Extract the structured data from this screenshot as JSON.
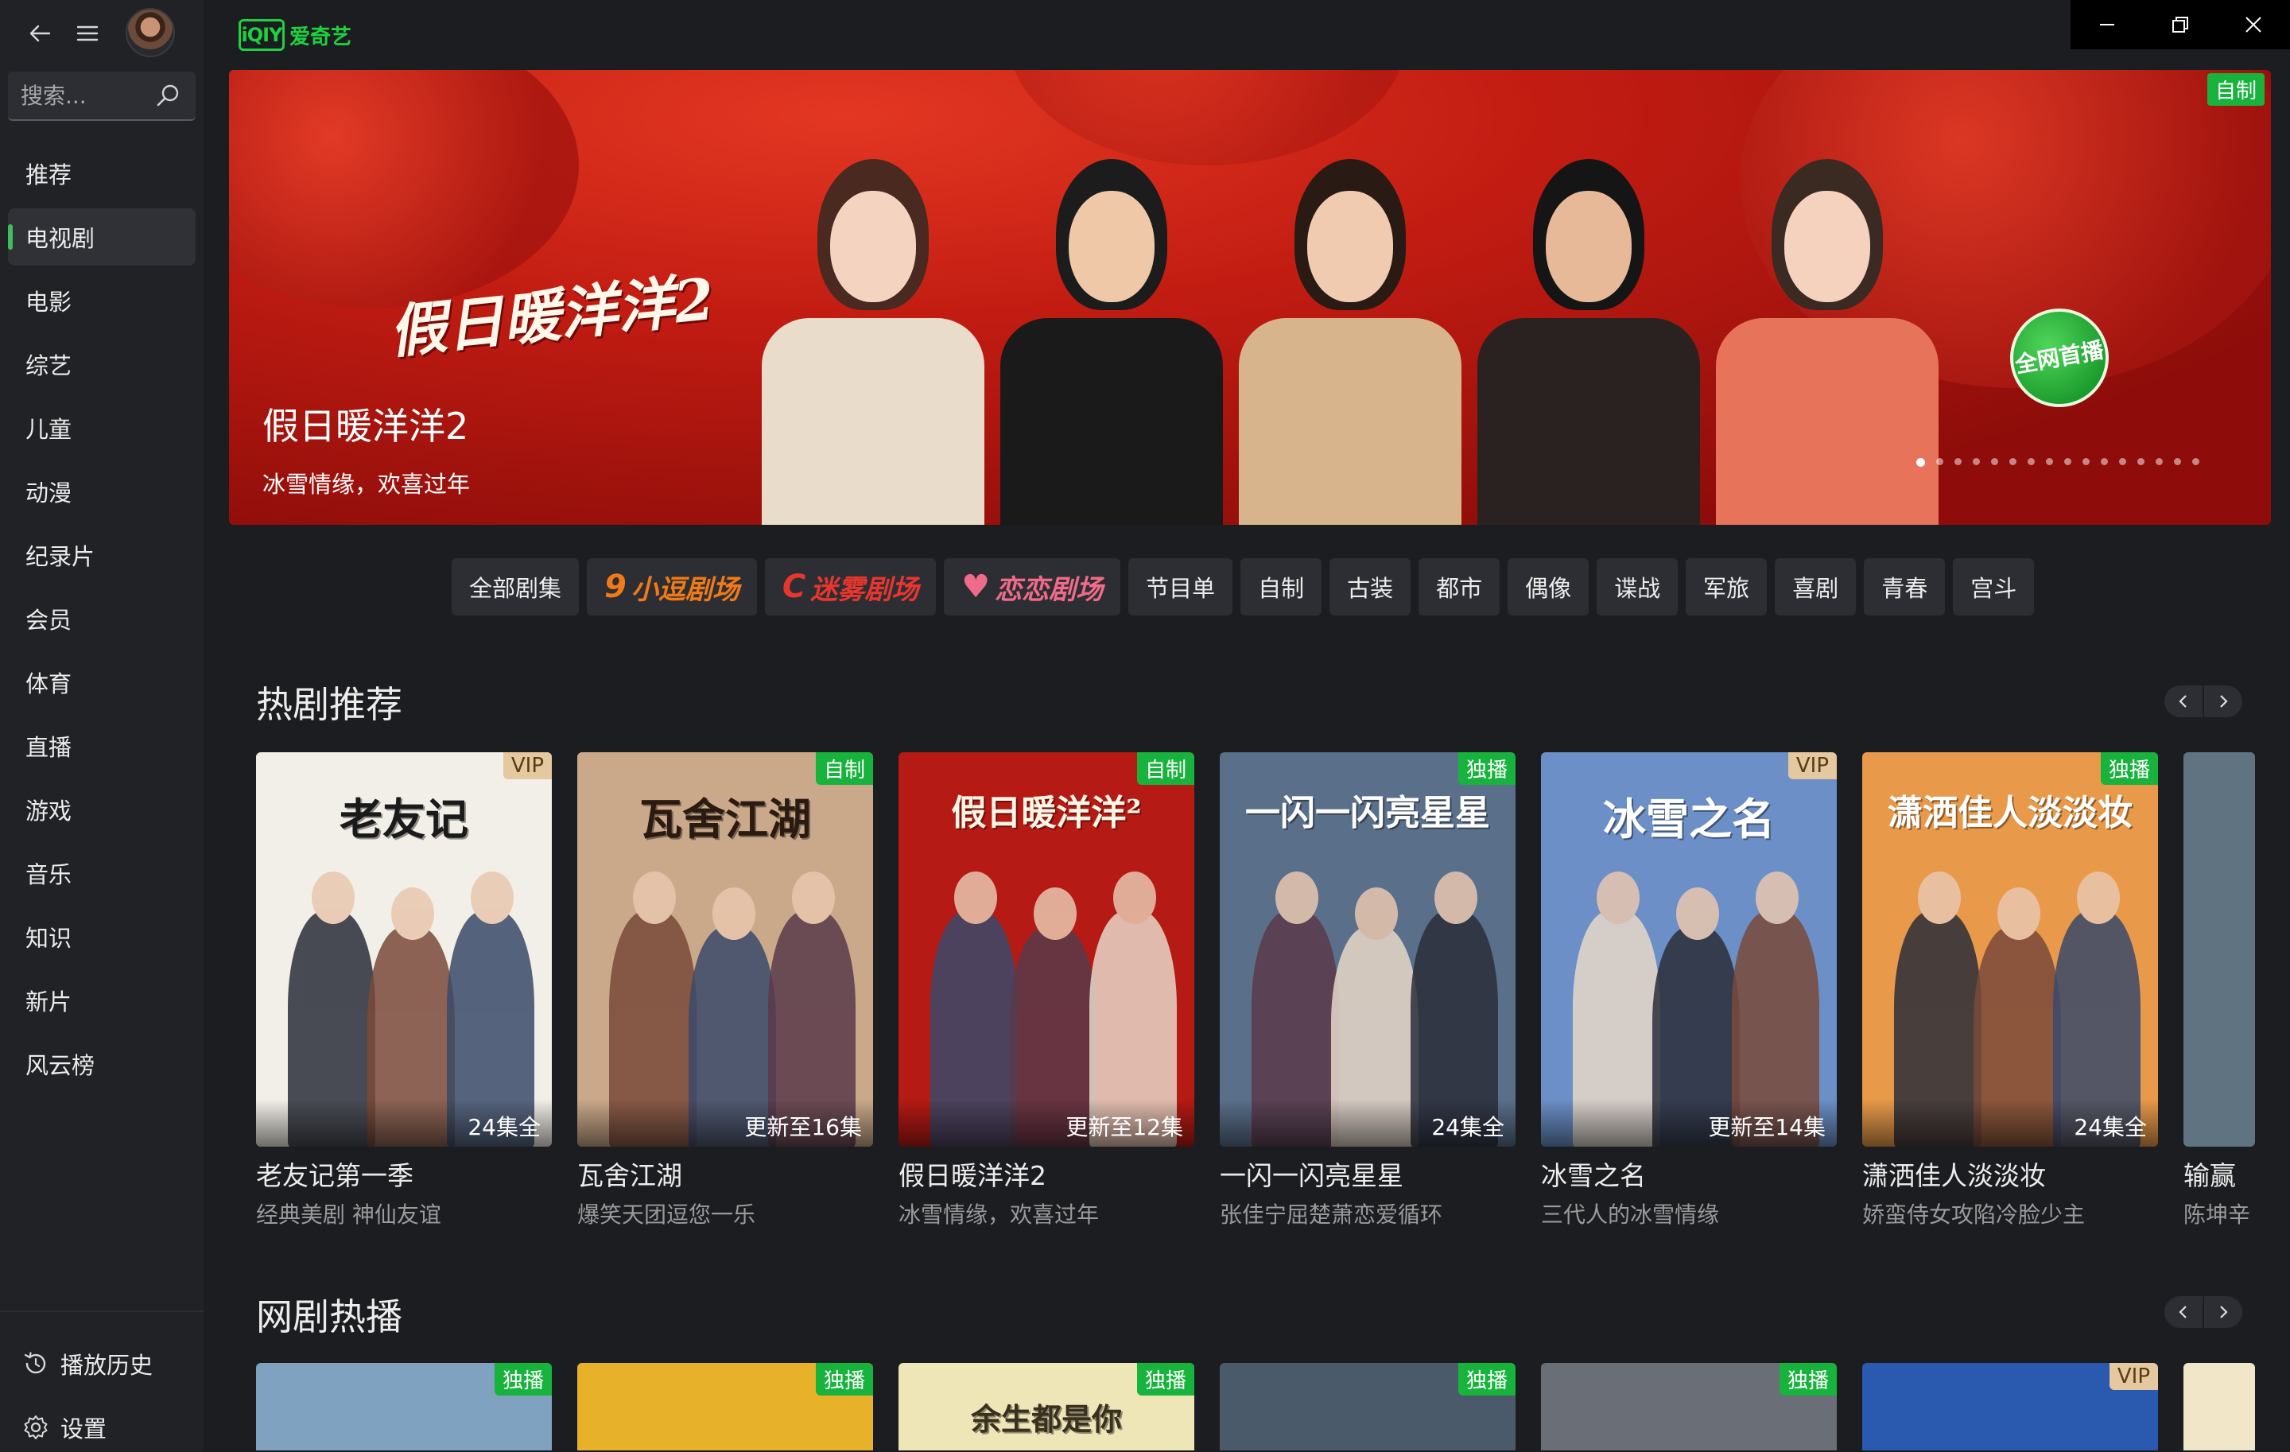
{
  "app": {
    "logo_badge": "iQIY",
    "logo_text": "爱奇艺"
  },
  "search": {
    "placeholder": "搜索..."
  },
  "sidebar": {
    "items": [
      {
        "label": "推荐",
        "id": "recommend"
      },
      {
        "label": "电视剧",
        "id": "tv",
        "active": true
      },
      {
        "label": "电影",
        "id": "movie"
      },
      {
        "label": "综艺",
        "id": "variety"
      },
      {
        "label": "儿童",
        "id": "kids"
      },
      {
        "label": "动漫",
        "id": "anime"
      },
      {
        "label": "纪录片",
        "id": "documentary"
      },
      {
        "label": "会员",
        "id": "member"
      },
      {
        "label": "体育",
        "id": "sports"
      },
      {
        "label": "直播",
        "id": "live"
      },
      {
        "label": "游戏",
        "id": "game"
      },
      {
        "label": "音乐",
        "id": "music"
      },
      {
        "label": "知识",
        "id": "knowledge"
      },
      {
        "label": "新片",
        "id": "new"
      },
      {
        "label": "风云榜",
        "id": "ranking"
      }
    ],
    "history_label": "播放历史",
    "settings_label": "设置"
  },
  "banner": {
    "logo_title": "假日暖洋洋2",
    "title": "假日暖洋洋2",
    "subtitle": "冰雪情缘，欢喜过年",
    "tag": "自制",
    "firstrun_badge": "全网首播",
    "dot_count": 16,
    "active_dot": 0
  },
  "chips": [
    {
      "label": "全部剧集",
      "type": "text"
    },
    {
      "label": "小逗剧场",
      "type": "brand",
      "icon": "9",
      "color": "#f07a18"
    },
    {
      "label": "迷雾剧场",
      "type": "brand",
      "icon": "C",
      "color": "#e8362e"
    },
    {
      "label": "恋恋剧场",
      "type": "brand",
      "icon": "♥",
      "color": "#f06a8a"
    },
    {
      "label": "节目单",
      "type": "text"
    },
    {
      "label": "自制",
      "type": "text"
    },
    {
      "label": "古装",
      "type": "text"
    },
    {
      "label": "都市",
      "type": "text"
    },
    {
      "label": "偶像",
      "type": "text"
    },
    {
      "label": "谍战",
      "type": "text"
    },
    {
      "label": "军旅",
      "type": "text"
    },
    {
      "label": "喜剧",
      "type": "text"
    },
    {
      "label": "青春",
      "type": "text"
    },
    {
      "label": "宫斗",
      "type": "text"
    }
  ],
  "sections": [
    {
      "title": "热剧推荐",
      "cards": [
        {
          "name": "老友记第一季",
          "desc": "经典美剧 神仙友谊",
          "badge": "VIP",
          "badge_style": "vip",
          "episodes": "24集全",
          "poster_text": "老友记",
          "bg": "#f2efe8",
          "text_color": "#1a1a1a"
        },
        {
          "name": "瓦舍江湖",
          "desc": "爆笑天团逗您一乐",
          "badge": "自制",
          "badge_style": "green",
          "episodes": "更新至16集",
          "poster_text": "瓦舍江湖",
          "bg": "#c9a98a",
          "text_color": "#2a1a10"
        },
        {
          "name": "假日暖洋洋2",
          "desc": "冰雪情缘，欢喜过年",
          "badge": "自制",
          "badge_style": "green",
          "episodes": "更新至12集",
          "poster_text": "假日暖洋洋²",
          "bg": "#b51a14",
          "text_color": "#fff6e6"
        },
        {
          "name": "一闪一闪亮星星",
          "desc": "张佳宁屈楚萧恋爱循环",
          "badge": "独播",
          "badge_style": "green",
          "episodes": "24集全",
          "poster_text": "一闪一闪亮星星",
          "bg": "#5a6f8a",
          "text_color": "#ffffff"
        },
        {
          "name": "冰雪之名",
          "desc": "三代人的冰雪情缘",
          "badge": "VIP",
          "badge_style": "vip",
          "episodes": "更新至14集",
          "poster_text": "冰雪之名",
          "bg": "#6b8fc6",
          "text_color": "#ffffff"
        },
        {
          "name": "潇洒佳人淡淡妆",
          "desc": "娇蛮侍女攻陷冷脸少主",
          "badge": "独播",
          "badge_style": "green",
          "episodes": "24集全",
          "poster_text": "潇洒佳人淡淡妆",
          "bg": "#e89a4a",
          "text_color": "#ffffff"
        },
        {
          "name": "输赢",
          "desc": "陈坤辛",
          "badge": "",
          "badge_style": "",
          "episodes": "",
          "poster_text": "",
          "bg": "#5f7480",
          "text_color": "#ffffff"
        }
      ]
    },
    {
      "title": "网剧热播",
      "cards": [
        {
          "badge": "独播",
          "badge_style": "green",
          "bg": "#7fa2c0"
        },
        {
          "badge": "独播",
          "badge_style": "green",
          "bg": "#e8b12a"
        },
        {
          "badge": "独播",
          "badge_style": "green",
          "bg": "#efe6b8",
          "poster_text": "余生都是你"
        },
        {
          "badge": "独播",
          "badge_style": "green",
          "bg": "#4a5a6a"
        },
        {
          "badge": "独播",
          "badge_style": "green",
          "bg": "#6a6e76"
        },
        {
          "badge": "VIP",
          "badge_style": "vip",
          "bg": "#2a5ab0"
        },
        {
          "badge": "",
          "badge_style": "",
          "bg": "#f2e6c8"
        }
      ]
    }
  ]
}
